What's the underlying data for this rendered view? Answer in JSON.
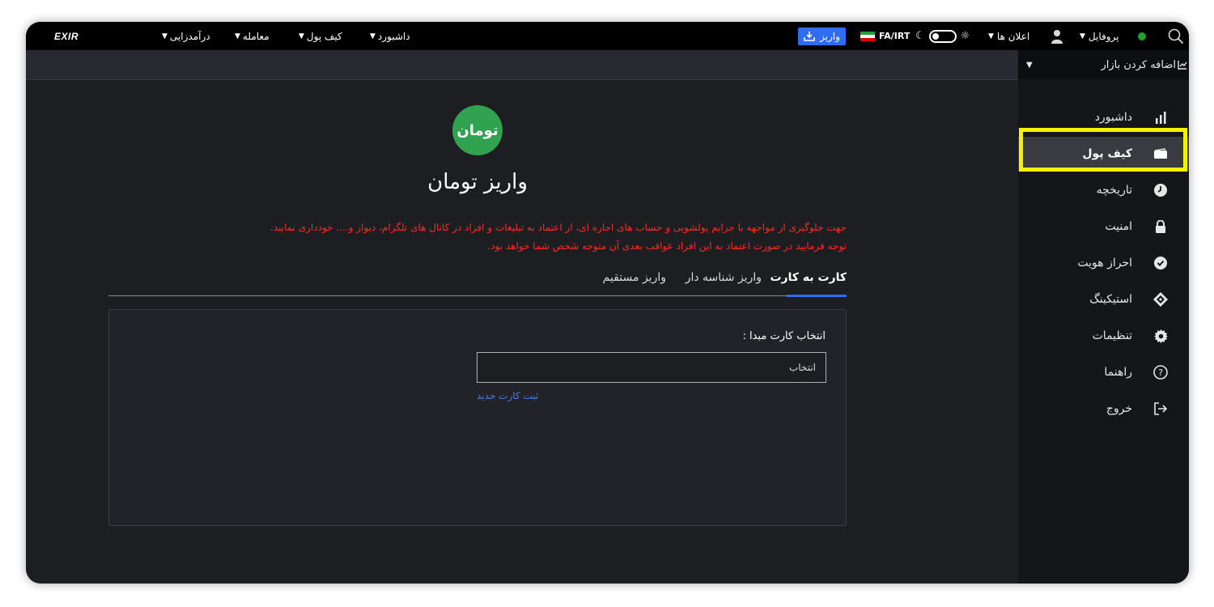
{
  "topbar": {
    "logo": "EXIR",
    "nav": [
      "درآمدزایی",
      "معامله",
      "کیف پول",
      "داشبورد"
    ],
    "deposit_label": "واریز",
    "locale": "FA/IRT",
    "announcements": "اعلان ها",
    "profile": "پروفایل"
  },
  "sidebar": {
    "add_market": "اضافه کردن بازار",
    "items": [
      "داشبورد",
      "کیف پول",
      "تاریخچه",
      "امنیت",
      "احراز هویت",
      "استیکینگ",
      "تنظیمات",
      "راهنما",
      "خروج"
    ],
    "active_index": 1
  },
  "main": {
    "token_label": "تومان",
    "title": "واریز تومان",
    "warning_line1": "جهت جلوگیری از مواجهه با جرایم پولشویی و حساب های اجاره ای، از اعتماد به تبلیغات و افراد در کانال های تلگرام، دیوار و.... خودداری نمایید.",
    "warning_line2": "توجه فرمایید در صورت اعتماد به این افراد عواقب بعدی آن متوجه شخص شما خواهد بود.",
    "tabs": [
      "کارت به کارت",
      "واریز شناسه دار",
      "واریز مستقیم"
    ],
    "card_label": "انتخاب کارت مبدا :",
    "select_value": "انتخاب",
    "register_card": "ثبت کارت جدید"
  },
  "colors": {
    "accent": "#2f6cf0",
    "warning": "#ff2828",
    "highlight": "#f7f000",
    "token": "#31a24f",
    "online": "#1ea22d"
  }
}
